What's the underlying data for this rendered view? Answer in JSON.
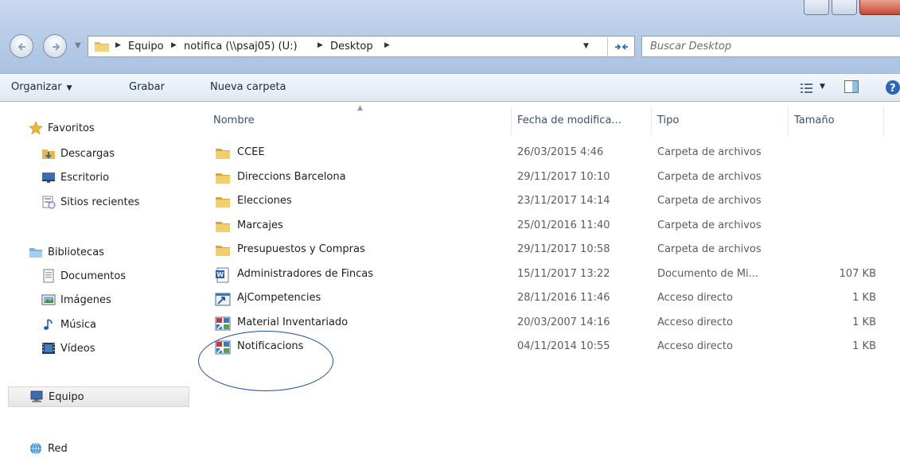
{
  "address": {
    "crumbs": [
      "Equipo",
      "notifica (\\\\psaj05) (U:)",
      "Desktop"
    ]
  },
  "search": {
    "placeholder": "Buscar Desktop"
  },
  "toolbar": {
    "organize_label": "Organizar",
    "burn_label": "Grabar",
    "new_folder_label": "Nueva carpeta"
  },
  "nav": {
    "favorites": {
      "label": "Favoritos",
      "items": [
        {
          "label": "Descargas",
          "icon": "downloads-icon"
        },
        {
          "label": "Escritorio",
          "icon": "desktop-icon"
        },
        {
          "label": "Sitios recientes",
          "icon": "recent-places-icon"
        }
      ]
    },
    "libraries": {
      "label": "Bibliotecas",
      "items": [
        {
          "label": "Documentos",
          "icon": "documents-icon"
        },
        {
          "label": "Imágenes",
          "icon": "pictures-icon"
        },
        {
          "label": "Música",
          "icon": "music-icon"
        },
        {
          "label": "Vídeos",
          "icon": "videos-icon"
        }
      ]
    },
    "computer": {
      "label": "Equipo",
      "selected": true
    },
    "network": {
      "label": "Red"
    }
  },
  "columns": [
    "Nombre",
    "Fecha de modifica...",
    "Tipo",
    "Tamaño"
  ],
  "files": [
    {
      "name": "CCEE",
      "date": "26/03/2015 4:46",
      "type": "Carpeta de archivos",
      "size": "",
      "icon": "folder-icon"
    },
    {
      "name": "Direccions Barcelona",
      "date": "29/11/2017 10:10",
      "type": "Carpeta de archivos",
      "size": "",
      "icon": "folder-icon"
    },
    {
      "name": "Elecciones",
      "date": "23/11/2017 14:14",
      "type": "Carpeta de archivos",
      "size": "",
      "icon": "folder-icon"
    },
    {
      "name": "Marcajes",
      "date": "25/01/2016 11:40",
      "type": "Carpeta de archivos",
      "size": "",
      "icon": "folder-icon"
    },
    {
      "name": "Presupuestos y Compras",
      "date": "29/11/2017 10:58",
      "type": "Carpeta de archivos",
      "size": "",
      "icon": "folder-icon"
    },
    {
      "name": "Administradores de Fincas",
      "date": "15/11/2017 13:22",
      "type": "Documento de Mi...",
      "size": "107 KB",
      "icon": "word-document-icon"
    },
    {
      "name": "AjCompetencies",
      "date": "28/11/2016 11:46",
      "type": "Acceso directo",
      "size": "1 KB",
      "icon": "shortcut-icon"
    },
    {
      "name": "Material Inventariado",
      "date": "20/03/2007 14:16",
      "type": "Acceso directo",
      "size": "1 KB",
      "icon": "shortcut-app-icon"
    },
    {
      "name": "Notificacions",
      "date": "04/11/2014 10:55",
      "type": "Acceso directo",
      "size": "1 KB",
      "icon": "shortcut-app-icon"
    }
  ],
  "colors": {
    "accent": "#1f4f9a",
    "folder": "#e8b94a",
    "header_text": "#3b4f6b"
  }
}
